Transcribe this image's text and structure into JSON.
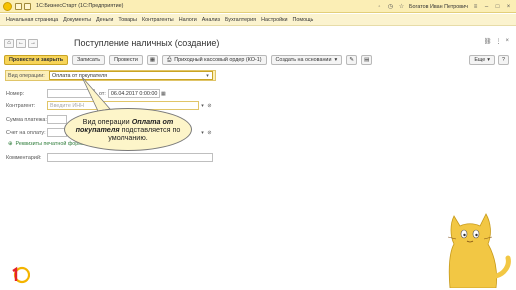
{
  "titlebar": {
    "title": "1С:БизнесСтарт  (1С:Предприятие)",
    "user": "Богатов Иван Петрович"
  },
  "menu": {
    "items": [
      "Начальная страница",
      "Документы",
      "Деньги",
      "Товары",
      "Контрагенты",
      "Налоги",
      "Анализ",
      "Бухгалтерия",
      "Настройки",
      "Помощь"
    ]
  },
  "form": {
    "title": "Поступление наличных (создание)"
  },
  "toolbar": {
    "post_close": "Провести и закрыть",
    "save": "Записать",
    "post": "Провести",
    "print_order": "Приходный кассовый ордер (КО-1)",
    "create_based": "Создать на основании",
    "more": "Еще",
    "help": "?"
  },
  "fields": {
    "operation_label": "Вид операции:",
    "operation_value": "Оплата от покупателя",
    "number_label": "Номер:",
    "from_label": "от:",
    "date_value": "06.04.2017  0:00:00",
    "counterparty_label": "Контрагент:",
    "counterparty_placeholder": "Введите ИНН",
    "amount_label": "Сумма платежа:",
    "invoice_label": "Счет на оплату:",
    "print_details_link": "Реквизиты печатной формы",
    "comment_label": "Комментарий:"
  },
  "balloon": {
    "prefix": "Вид операции ",
    "bold": "Оплата от покупателя",
    "suffix": " подставляется по умолчанию."
  },
  "colors": {
    "primary_button": "#f7d458",
    "titlebar": "#fbeeb5",
    "balloon": "#fdf5c9",
    "cat": "#f2c744"
  }
}
